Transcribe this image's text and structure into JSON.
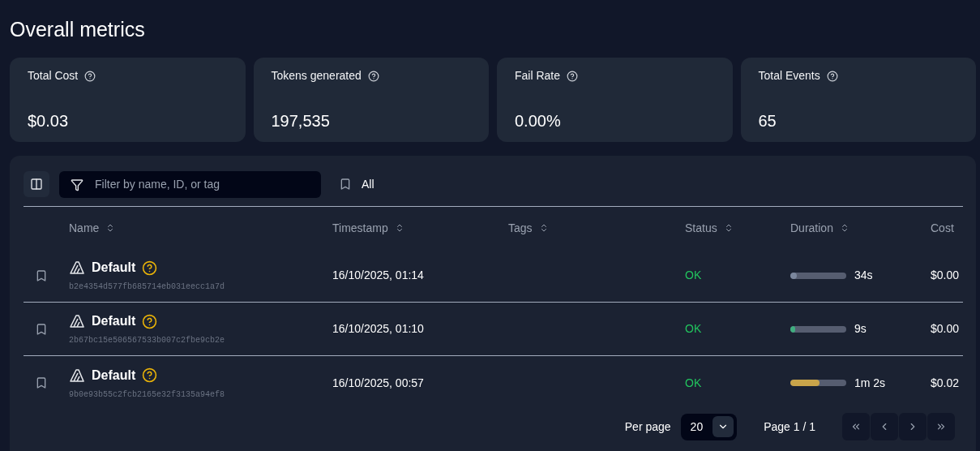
{
  "title": "Overall metrics",
  "metrics": [
    {
      "label": "Total Cost",
      "value": "$0.03"
    },
    {
      "label": "Tokens generated",
      "value": "197,535"
    },
    {
      "label": "Fail Rate",
      "value": "0.00%"
    },
    {
      "label": "Total Events",
      "value": "65"
    }
  ],
  "filter": {
    "placeholder": "Filter by name, ID, or tag"
  },
  "bookmark_filter": "All",
  "table": {
    "columns": [
      {
        "label": "Name",
        "sortable": true
      },
      {
        "label": "Timestamp",
        "sortable": true
      },
      {
        "label": "Tags",
        "sortable": true
      },
      {
        "label": "Status",
        "sortable": true
      },
      {
        "label": "Duration",
        "sortable": true
      },
      {
        "label": "Cost",
        "sortable": false
      }
    ],
    "rows": [
      {
        "name": "Default",
        "id": "b2e4354d577fb685714eb031eecc1a7d",
        "timestamp": "16/10/2025, 01:14",
        "status": "OK",
        "duration": {
          "level": 0.12,
          "color": "#7b879d",
          "reading": "34s"
        },
        "cost": "$0.00"
      },
      {
        "name": "Default",
        "id": "2b67bc15e506567533b007c2fbe9cb2e",
        "timestamp": "16/10/2025, 01:10",
        "status": "OK",
        "duration": {
          "level": 0.08,
          "color": "#3fae7f",
          "reading": "9s"
        },
        "cost": "$0.00"
      },
      {
        "name": "Default",
        "id": "9b0e93b55c2fcb2165e32f3135a94ef8",
        "timestamp": "16/10/2025, 00:57",
        "status": "OK",
        "duration": {
          "level": 0.52,
          "color": "#c9a44a",
          "reading": "1m 2s"
        },
        "cost": "$0.02"
      }
    ]
  },
  "pagination": {
    "per_page_label": "Per page",
    "per_page": "20",
    "page": "Page 1 / 1"
  }
}
